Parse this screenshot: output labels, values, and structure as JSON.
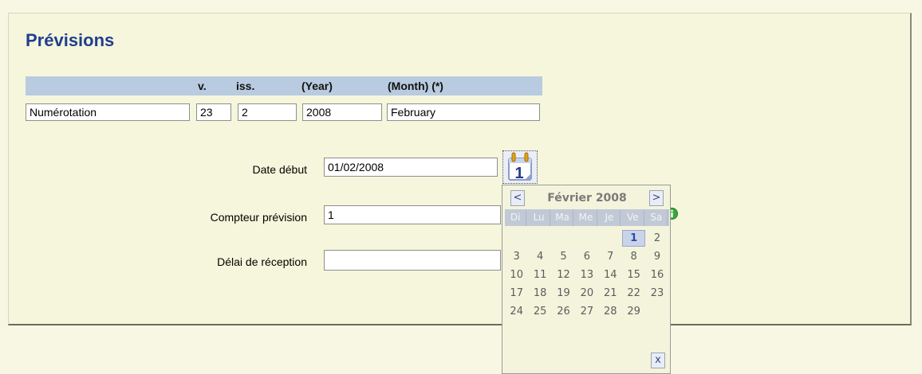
{
  "title": "Prévisions",
  "table": {
    "headers": {
      "label": "",
      "v": "v.",
      "iss": "iss.",
      "year": "(Year)",
      "month": "(Month) (*)"
    },
    "row": {
      "label": "Numérotation",
      "v": "23",
      "iss": "2",
      "year": "2008",
      "month": "February"
    }
  },
  "form": {
    "date_debut": {
      "label": "Date début",
      "value": "01/02/2008"
    },
    "compteur": {
      "label": "Compteur prévision",
      "value": "1"
    },
    "delai": {
      "label": "Délai de réception",
      "value": ""
    }
  },
  "calendar_button": {
    "digit": "1",
    "icon": "calendar-icon"
  },
  "calendar": {
    "month_label": "Février 2008",
    "prev": "<",
    "next": ">",
    "close": "x",
    "weekdays": [
      "Di",
      "Lu",
      "Ma",
      "Me",
      "Je",
      "Ve",
      "Sa"
    ],
    "weeks": [
      [
        "",
        "",
        "",
        "",
        "",
        "1",
        "2"
      ],
      [
        "3",
        "4",
        "5",
        "6",
        "7",
        "8",
        "9"
      ],
      [
        "10",
        "11",
        "12",
        "13",
        "14",
        "15",
        "16"
      ],
      [
        "17",
        "18",
        "19",
        "20",
        "21",
        "22",
        "23"
      ],
      [
        "24",
        "25",
        "26",
        "27",
        "28",
        "29",
        ""
      ]
    ],
    "selected": "1"
  },
  "info_icon": "info-icon",
  "colors": {
    "title": "#1f3f8f",
    "header_bg": "#b8cbe0",
    "panel_bg": "#f6f6dc",
    "info_green": "#3aa83a"
  }
}
